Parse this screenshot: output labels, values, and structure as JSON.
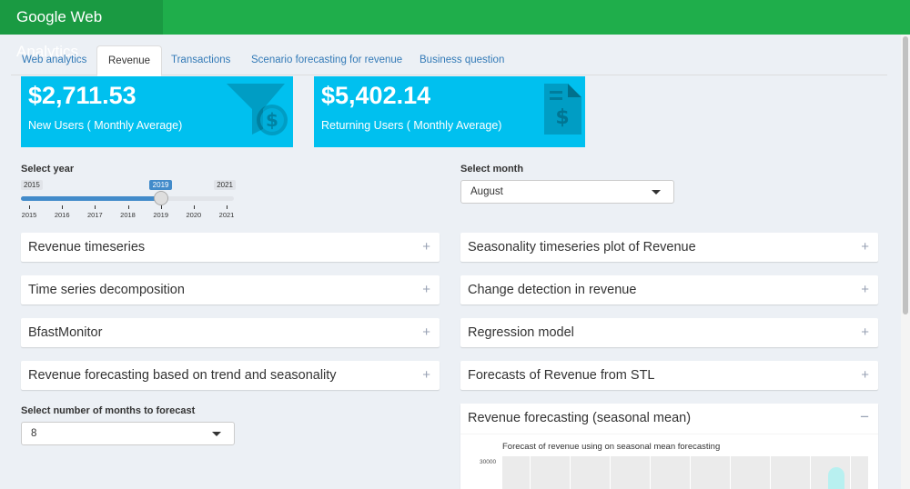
{
  "app": {
    "title": "Google Web Analytics"
  },
  "tabs": [
    {
      "label": "Web analytics"
    },
    {
      "label": "Revenue"
    },
    {
      "label": "Transactions"
    },
    {
      "label": "Scenario forecasting for revenue"
    },
    {
      "label": "Business question"
    }
  ],
  "value_boxes": [
    {
      "value": "$2,711.53",
      "label": "New Users ( Monthly Average)",
      "icon": "funnel-dollar-icon"
    },
    {
      "value": "$5,402.14",
      "label": "Returning Users ( Monthly Average)",
      "icon": "invoice-dollar-icon"
    }
  ],
  "year_slider": {
    "label": "Select year",
    "min_label": "2015",
    "max_label": "2021",
    "current_label": "2019",
    "value_fraction": 0.6667,
    "ticks": [
      "2015",
      "2016",
      "2017",
      "2018",
      "2019",
      "2020",
      "2021"
    ]
  },
  "month_select": {
    "label": "Select month",
    "value": "August"
  },
  "forecast_select": {
    "label": "Select number of months to forecast",
    "value": "8"
  },
  "boxes_left": [
    {
      "title": "Revenue timeseries",
      "toggle": "+"
    },
    {
      "title": "Time series decomposition",
      "toggle": "+"
    },
    {
      "title": "BfastMonitor",
      "toggle": "+"
    },
    {
      "title": "Revenue forecasting based on trend and seasonality",
      "toggle": "+"
    }
  ],
  "boxes_right": [
    {
      "title": "Seasonality timeseries plot of Revenue",
      "toggle": "+"
    },
    {
      "title": "Change detection in revenue",
      "toggle": "+"
    },
    {
      "title": "Regression model",
      "toggle": "+"
    },
    {
      "title": "Forecasts of Revenue from STL",
      "toggle": "+"
    }
  ],
  "expanded_box": {
    "title": "Revenue forecasting (seasonal mean)",
    "toggle": "−",
    "plot_title": "Forecast of revenue using on seasonal mean forecasting",
    "y_tick": "30000"
  },
  "colors": {
    "header": "#1fae4b",
    "logo": "#1a9a42",
    "value_box": "#00c0ef",
    "slider": "#428bca"
  }
}
